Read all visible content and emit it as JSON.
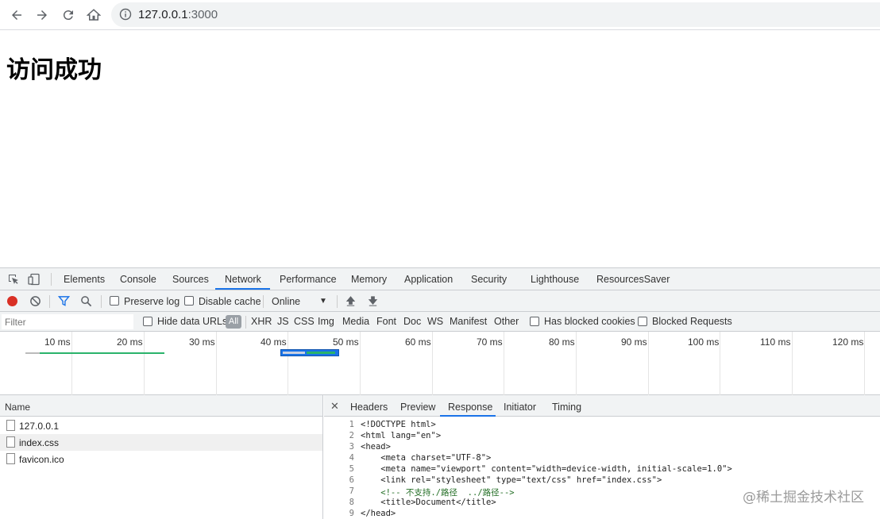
{
  "browser": {
    "url_host": "127.0.0.1",
    "url_port": ":3000"
  },
  "page": {
    "heading": "访问成功"
  },
  "devtools": {
    "tabs": [
      "Elements",
      "Console",
      "Sources",
      "Network",
      "Performance",
      "Memory",
      "Application",
      "Security",
      "Lighthouse",
      "ResourcesSaver"
    ],
    "active_tab": "Network",
    "toolbar": {
      "preserve_log": "Preserve log",
      "disable_cache": "Disable cache",
      "throttle": "Online"
    },
    "filterbar": {
      "placeholder": "Filter",
      "hide_data_urls": "Hide data URLs",
      "all": "All",
      "types": [
        "XHR",
        "JS",
        "CSS",
        "Img",
        "Media",
        "Font",
        "Doc",
        "WS",
        "Manifest",
        "Other"
      ],
      "has_blocked_cookies": "Has blocked cookies",
      "blocked_requests": "Blocked Requests"
    },
    "overview": {
      "ticks": [
        "10 ms",
        "20 ms",
        "30 ms",
        "40 ms",
        "50 ms",
        "60 ms",
        "70 ms",
        "80 ms",
        "90 ms",
        "100 ms",
        "110 ms",
        "120 ms"
      ]
    },
    "requests": {
      "column": "Name",
      "items": [
        "127.0.0.1",
        "index.css",
        "favicon.ico"
      ]
    },
    "detail": {
      "tabs": [
        "Headers",
        "Preview",
        "Response",
        "Initiator",
        "Timing"
      ],
      "active_tab": "Response",
      "lines": [
        {
          "n": "1",
          "text": "<!DOCTYPE html>"
        },
        {
          "n": "2",
          "text": "<html lang=\"en\">"
        },
        {
          "n": "3",
          "text": "<head>"
        },
        {
          "n": "4",
          "text": "    <meta charset=\"UTF-8\">"
        },
        {
          "n": "5",
          "text": "    <meta name=\"viewport\" content=\"width=device-width, initial-scale=1.0\">"
        },
        {
          "n": "6",
          "text": "    <link rel=\"stylesheet\" type=\"text/css\" href=\"index.css\">"
        },
        {
          "n": "7",
          "text": "    <!-- 不支持./路径  ../路径-->"
        },
        {
          "n": "8",
          "text": "    <title>Document</title>"
        },
        {
          "n": "9",
          "text": "</head>"
        }
      ]
    }
  },
  "watermark": "@稀土掘金技术社区"
}
